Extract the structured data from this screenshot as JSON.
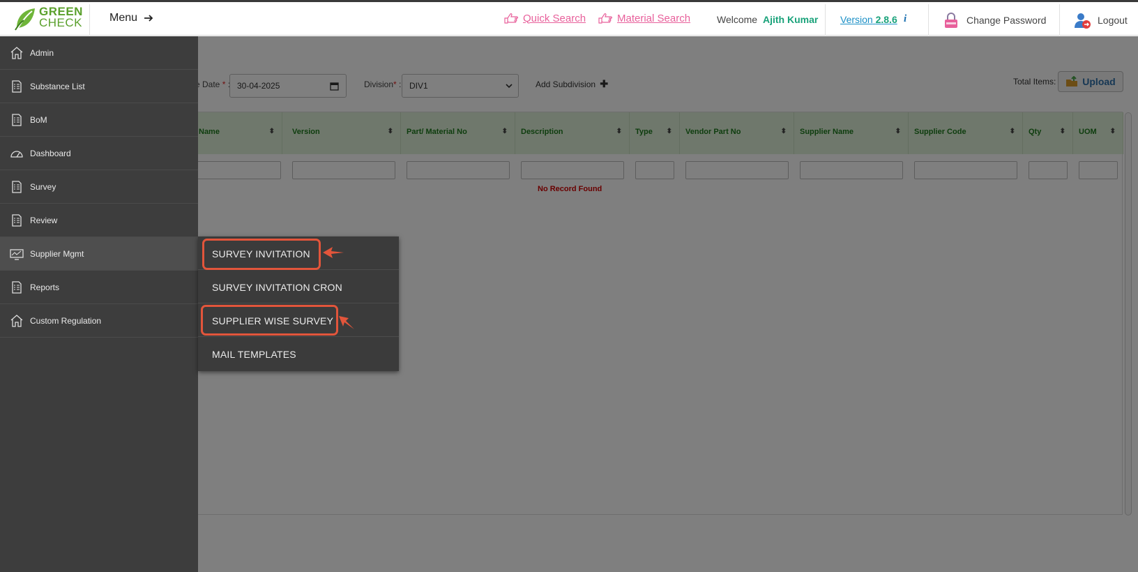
{
  "header": {
    "logo_line1": "GREEN",
    "logo_line2": "CHECK",
    "menu_label": "Menu",
    "quick_search": "Quick Search",
    "material_search": "Material Search",
    "welcome_label": "Welcome",
    "user_name": "Ajith Kumar",
    "version_label": "Version",
    "version_number": "2.8.6",
    "info_glyph": "i",
    "change_password": "Change Password",
    "logout": "Logout"
  },
  "toolbar": {
    "date_label": "e Date",
    "date_value": "30-04-2025",
    "division_label": "Division",
    "division_value": "DIV1",
    "required_mark": "*",
    "colon": ":",
    "add_subdivision": "Add Subdivision",
    "total_items_label": "Total Items:",
    "upload_label": "Upload"
  },
  "grid": {
    "columns": [
      "Name",
      "Version",
      "Part/ Material No",
      "Description",
      "Type",
      "Vendor Part No",
      "Supplier Name",
      "Supplier Code",
      "Qty",
      "UOM"
    ],
    "empty_message": "No Record Found"
  },
  "sidebar": {
    "items": [
      {
        "label": "Admin",
        "icon": "home-icon"
      },
      {
        "label": "Substance List",
        "icon": "checklist-icon"
      },
      {
        "label": "BoM",
        "icon": "checklist-icon"
      },
      {
        "label": "Dashboard",
        "icon": "gauge-icon"
      },
      {
        "label": "Survey",
        "icon": "checklist-icon"
      },
      {
        "label": "Review",
        "icon": "checklist-icon"
      },
      {
        "label": "Supplier Mgmt",
        "icon": "monitor-chart-icon",
        "active": true
      },
      {
        "label": "Reports",
        "icon": "checklist-icon"
      },
      {
        "label": "Custom Regulation",
        "icon": "home-icon"
      }
    ]
  },
  "submenu": {
    "items": [
      "SURVEY INVITATION",
      "SURVEY INVITATION CRON",
      "SUPPLIER WISE SURVEY",
      "MAIL TEMPLATES"
    ]
  },
  "colors": {
    "brand_green": "#5aa02c",
    "link_pink": "#e8609b",
    "highlight_red": "#e2553b",
    "sidebar_bg": "#3d3d3d",
    "grid_header_bg": "#dff0d8"
  }
}
